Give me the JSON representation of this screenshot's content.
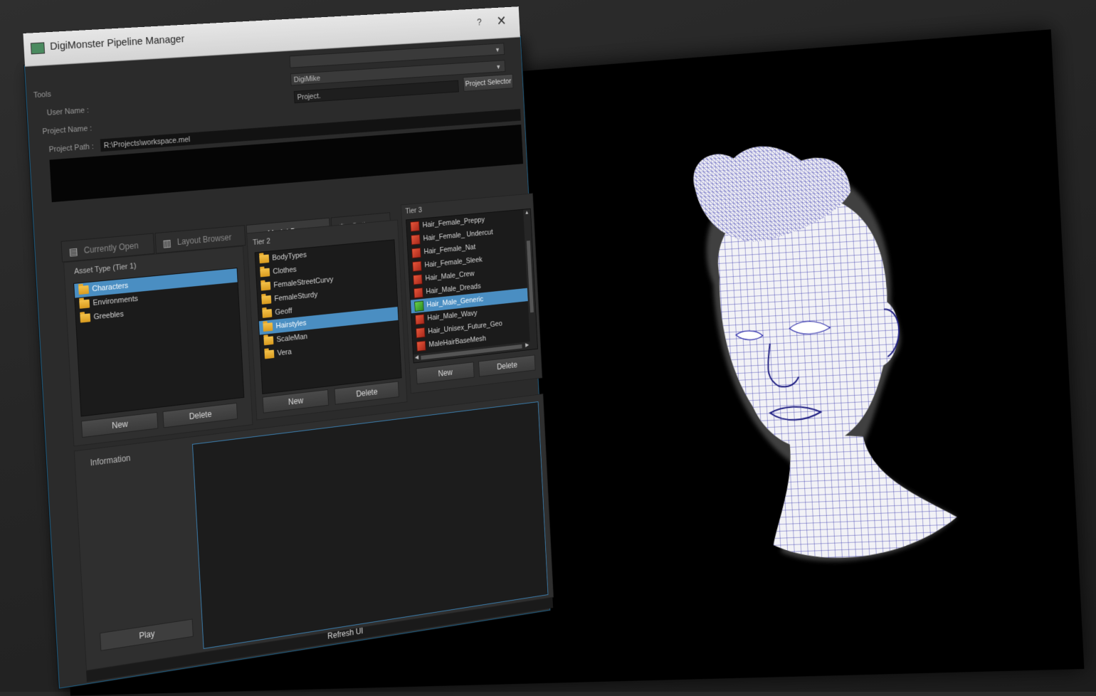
{
  "window": {
    "title": "DigiMonster Pipeline Manager",
    "help_label": "?",
    "close_label": "✕"
  },
  "header": {
    "tools_label": "Tools",
    "user_name_label": "User Name :",
    "project_name_label": "Project Name :",
    "project_path_label": "Project Path :",
    "user_combo_value": "DigiMike",
    "project_field_value": "Project.",
    "project_selector_label": "Project Selector",
    "project_path_value": "R:\\Projects\\workspace.mel"
  },
  "tabs": [
    {
      "label": "Currently Open",
      "icon": "document-icon",
      "active": false
    },
    {
      "label": "Layout Browser",
      "icon": "layout-icon",
      "active": false
    },
    {
      "label": "Model Browser",
      "icon": "model-icon",
      "active": true
    },
    {
      "label": "Options",
      "icon": "gear-icon",
      "active": false
    }
  ],
  "tier1": {
    "title": "Asset Type (Tier 1)",
    "items": [
      "Characters",
      "Environments",
      "Greebles"
    ],
    "selected": 0,
    "new_label": "New",
    "delete_label": "Delete"
  },
  "tier2": {
    "title": "Tier 2",
    "items": [
      "BodyTypes",
      "Clothes",
      "FemaleStreetCurvy",
      "FemaleSturdy",
      "Geoff",
      "Hairstyles",
      "ScaleMan",
      "Vera"
    ],
    "selected": 5,
    "new_label": "New",
    "delete_label": "Delete"
  },
  "tier3": {
    "title": "Tier 3",
    "items": [
      "Hair_Female_Preppy",
      "Hair_Female_ Undercut",
      "Hair_Female_Nat",
      "Hair_Female_Sleek",
      "Hair_Male_Crew",
      "Hair_Male_Dreads",
      "Hair_Male_Generic",
      "Hair_Male_Wavy",
      "Hair_Unisex_Future_Geo",
      "MaleHairBaseMesh"
    ],
    "selected": 6,
    "new_label": "New",
    "delete_label": "Delete"
  },
  "information": {
    "label": "Information",
    "play_label": "Play"
  },
  "footer": {
    "refresh_label": "Refresh UI"
  },
  "colors": {
    "selection": "#4a8ec2",
    "window_border": "#1d5f86",
    "wireframe": "#2a2aa8"
  }
}
